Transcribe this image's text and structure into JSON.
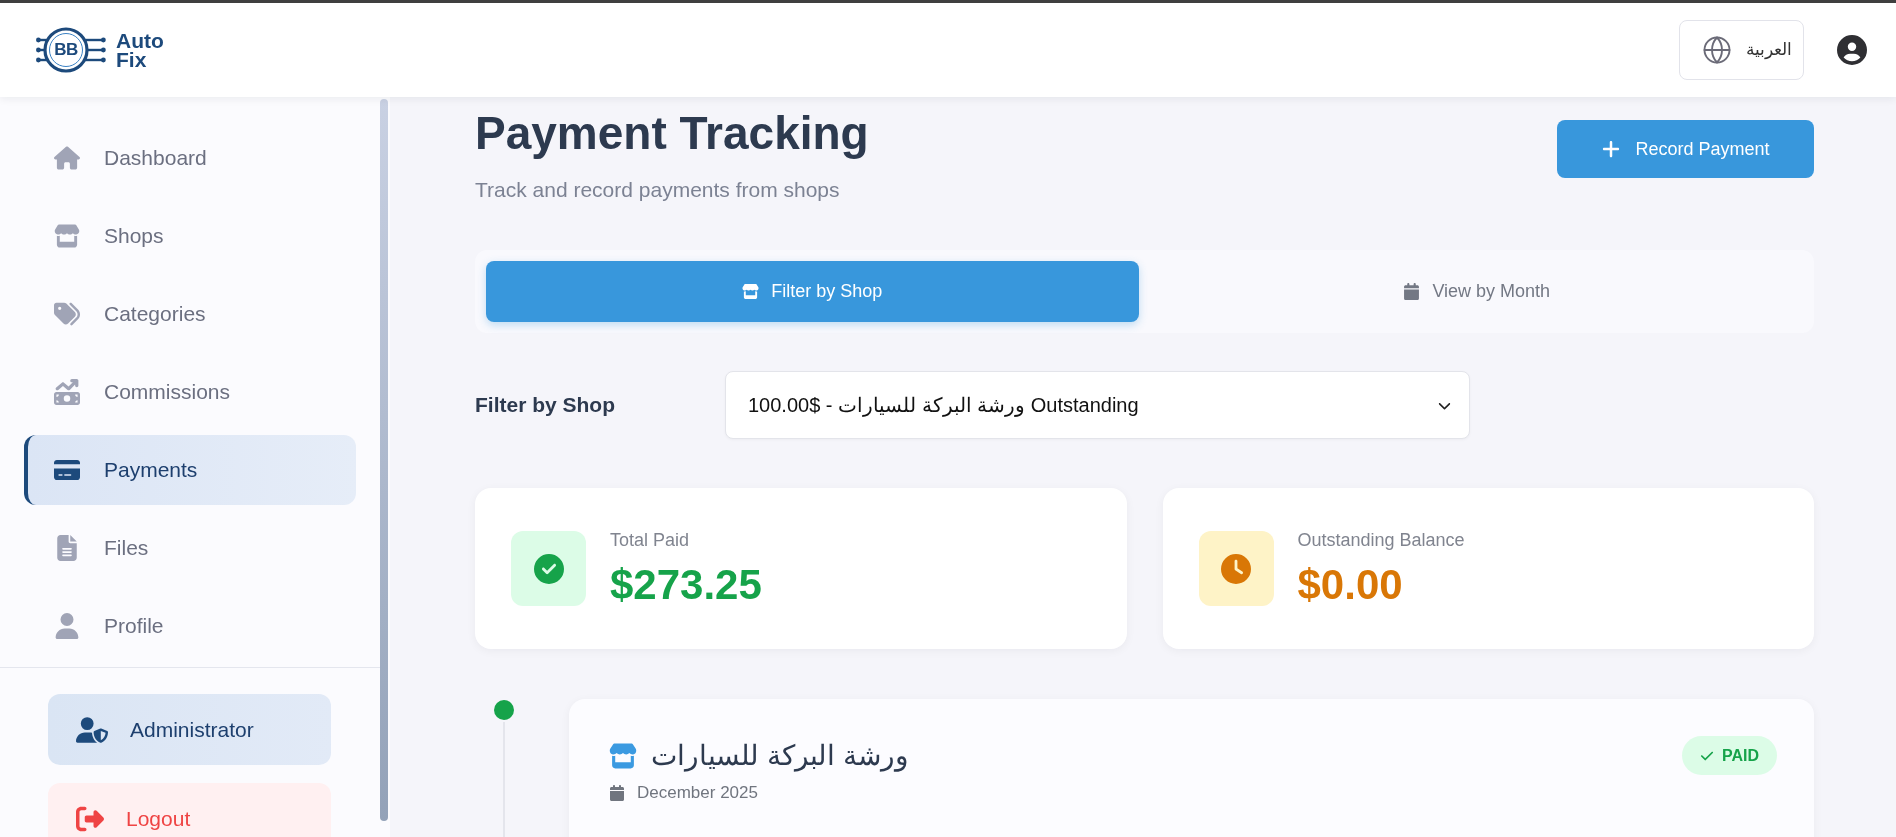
{
  "header": {
    "logo": {
      "monogram": "BB",
      "name_lines": [
        "Auto",
        "Fix"
      ]
    },
    "language_button": {
      "label": "العربية"
    }
  },
  "sidebar": {
    "items": [
      {
        "label": "Dashboard",
        "selected": false
      },
      {
        "label": "Shops",
        "selected": false
      },
      {
        "label": "Categories",
        "selected": false
      },
      {
        "label": "Commissions",
        "selected": false
      },
      {
        "label": "Payments",
        "selected": true
      },
      {
        "label": "Files",
        "selected": false
      },
      {
        "label": "Profile",
        "selected": false
      }
    ],
    "account_button": {
      "label": "Administrator"
    },
    "logout_button": {
      "label": "Logout"
    }
  },
  "page": {
    "title": "Payment Tracking",
    "subtitle": "Track and record payments from shops",
    "primary_button": {
      "label": "Record Payment"
    }
  },
  "view_tabs": [
    {
      "label": "Filter by Shop",
      "selected": true
    },
    {
      "label": "View by Month",
      "selected": false
    }
  ],
  "filter": {
    "label": "Filter by Shop",
    "value": "100.00$ - ورشة البركة للسيارات Outstanding"
  },
  "stats": [
    {
      "kind": "paid",
      "label": "Total Paid",
      "value": "$273.25"
    },
    {
      "kind": "outstanding",
      "label": "Outstanding Balance",
      "value": "$0.00"
    }
  ],
  "payments": [
    {
      "kind": "paid",
      "shop": "ورشة البركة للسيارات",
      "month": "December 2025",
      "status": "PAID"
    }
  ]
}
